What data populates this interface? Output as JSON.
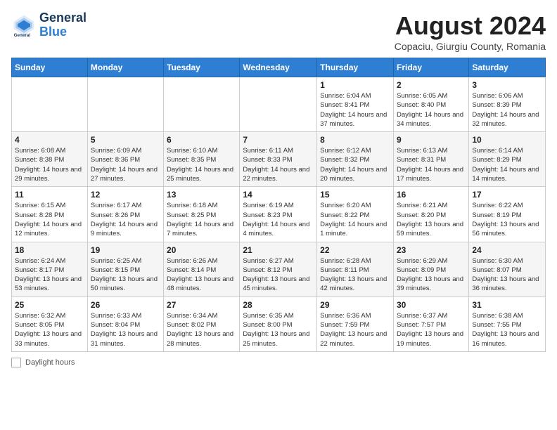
{
  "header": {
    "logo_line1": "General",
    "logo_line2": "Blue",
    "main_title": "August 2024",
    "subtitle": "Copaciu, Giurgiu County, Romania"
  },
  "days_of_week": [
    "Sunday",
    "Monday",
    "Tuesday",
    "Wednesday",
    "Thursday",
    "Friday",
    "Saturday"
  ],
  "weeks": [
    [
      {
        "day": "",
        "info": ""
      },
      {
        "day": "",
        "info": ""
      },
      {
        "day": "",
        "info": ""
      },
      {
        "day": "",
        "info": ""
      },
      {
        "day": "1",
        "info": "Sunrise: 6:04 AM\nSunset: 8:41 PM\nDaylight: 14 hours and 37 minutes."
      },
      {
        "day": "2",
        "info": "Sunrise: 6:05 AM\nSunset: 8:40 PM\nDaylight: 14 hours and 34 minutes."
      },
      {
        "day": "3",
        "info": "Sunrise: 6:06 AM\nSunset: 8:39 PM\nDaylight: 14 hours and 32 minutes."
      }
    ],
    [
      {
        "day": "4",
        "info": "Sunrise: 6:08 AM\nSunset: 8:38 PM\nDaylight: 14 hours and 29 minutes."
      },
      {
        "day": "5",
        "info": "Sunrise: 6:09 AM\nSunset: 8:36 PM\nDaylight: 14 hours and 27 minutes."
      },
      {
        "day": "6",
        "info": "Sunrise: 6:10 AM\nSunset: 8:35 PM\nDaylight: 14 hours and 25 minutes."
      },
      {
        "day": "7",
        "info": "Sunrise: 6:11 AM\nSunset: 8:33 PM\nDaylight: 14 hours and 22 minutes."
      },
      {
        "day": "8",
        "info": "Sunrise: 6:12 AM\nSunset: 8:32 PM\nDaylight: 14 hours and 20 minutes."
      },
      {
        "day": "9",
        "info": "Sunrise: 6:13 AM\nSunset: 8:31 PM\nDaylight: 14 hours and 17 minutes."
      },
      {
        "day": "10",
        "info": "Sunrise: 6:14 AM\nSunset: 8:29 PM\nDaylight: 14 hours and 14 minutes."
      }
    ],
    [
      {
        "day": "11",
        "info": "Sunrise: 6:15 AM\nSunset: 8:28 PM\nDaylight: 14 hours and 12 minutes."
      },
      {
        "day": "12",
        "info": "Sunrise: 6:17 AM\nSunset: 8:26 PM\nDaylight: 14 hours and 9 minutes."
      },
      {
        "day": "13",
        "info": "Sunrise: 6:18 AM\nSunset: 8:25 PM\nDaylight: 14 hours and 7 minutes."
      },
      {
        "day": "14",
        "info": "Sunrise: 6:19 AM\nSunset: 8:23 PM\nDaylight: 14 hours and 4 minutes."
      },
      {
        "day": "15",
        "info": "Sunrise: 6:20 AM\nSunset: 8:22 PM\nDaylight: 14 hours and 1 minute."
      },
      {
        "day": "16",
        "info": "Sunrise: 6:21 AM\nSunset: 8:20 PM\nDaylight: 13 hours and 59 minutes."
      },
      {
        "day": "17",
        "info": "Sunrise: 6:22 AM\nSunset: 8:19 PM\nDaylight: 13 hours and 56 minutes."
      }
    ],
    [
      {
        "day": "18",
        "info": "Sunrise: 6:24 AM\nSunset: 8:17 PM\nDaylight: 13 hours and 53 minutes."
      },
      {
        "day": "19",
        "info": "Sunrise: 6:25 AM\nSunset: 8:15 PM\nDaylight: 13 hours and 50 minutes."
      },
      {
        "day": "20",
        "info": "Sunrise: 6:26 AM\nSunset: 8:14 PM\nDaylight: 13 hours and 48 minutes."
      },
      {
        "day": "21",
        "info": "Sunrise: 6:27 AM\nSunset: 8:12 PM\nDaylight: 13 hours and 45 minutes."
      },
      {
        "day": "22",
        "info": "Sunrise: 6:28 AM\nSunset: 8:11 PM\nDaylight: 13 hours and 42 minutes."
      },
      {
        "day": "23",
        "info": "Sunrise: 6:29 AM\nSunset: 8:09 PM\nDaylight: 13 hours and 39 minutes."
      },
      {
        "day": "24",
        "info": "Sunrise: 6:30 AM\nSunset: 8:07 PM\nDaylight: 13 hours and 36 minutes."
      }
    ],
    [
      {
        "day": "25",
        "info": "Sunrise: 6:32 AM\nSunset: 8:05 PM\nDaylight: 13 hours and 33 minutes."
      },
      {
        "day": "26",
        "info": "Sunrise: 6:33 AM\nSunset: 8:04 PM\nDaylight: 13 hours and 31 minutes."
      },
      {
        "day": "27",
        "info": "Sunrise: 6:34 AM\nSunset: 8:02 PM\nDaylight: 13 hours and 28 minutes."
      },
      {
        "day": "28",
        "info": "Sunrise: 6:35 AM\nSunset: 8:00 PM\nDaylight: 13 hours and 25 minutes."
      },
      {
        "day": "29",
        "info": "Sunrise: 6:36 AM\nSunset: 7:59 PM\nDaylight: 13 hours and 22 minutes."
      },
      {
        "day": "30",
        "info": "Sunrise: 6:37 AM\nSunset: 7:57 PM\nDaylight: 13 hours and 19 minutes."
      },
      {
        "day": "31",
        "info": "Sunrise: 6:38 AM\nSunset: 7:55 PM\nDaylight: 13 hours and 16 minutes."
      }
    ]
  ],
  "footer": {
    "label": "Daylight hours"
  }
}
